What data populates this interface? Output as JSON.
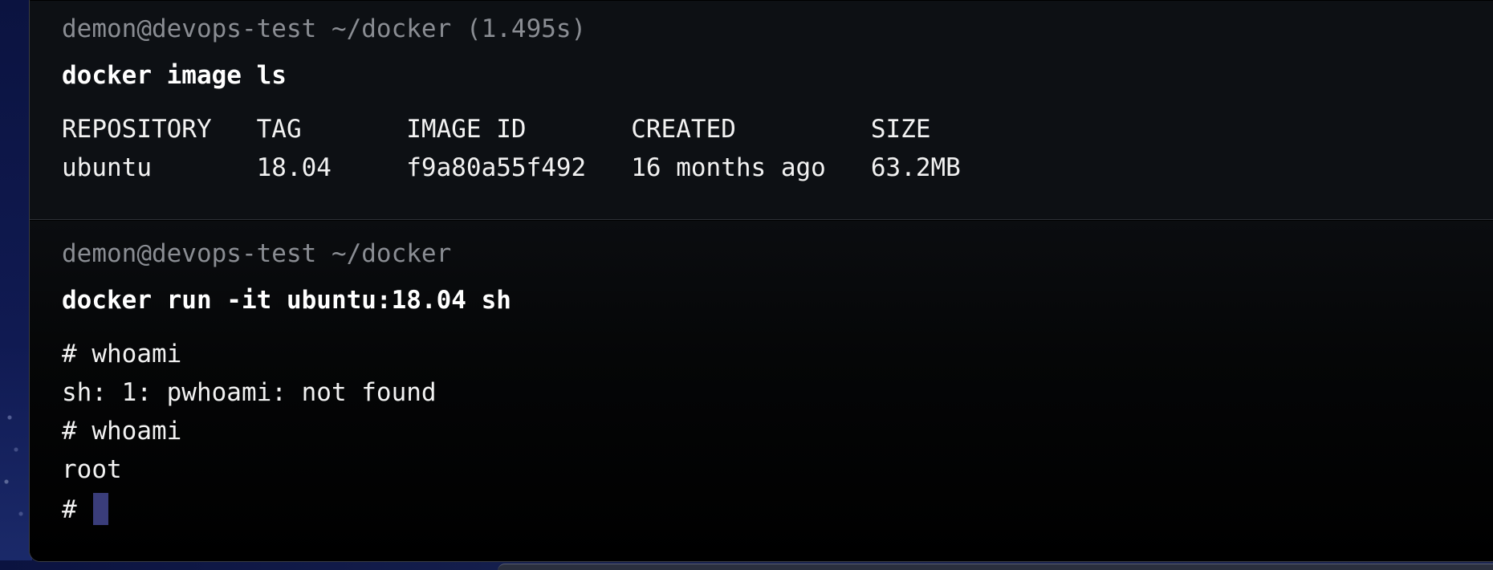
{
  "blocks": [
    {
      "prompt": "demon@devops-test ~/docker (1.495s)",
      "command": "docker image ls",
      "output_lines": [
        "REPOSITORY   TAG       IMAGE ID       CREATED         SIZE",
        "ubuntu       18.04     f9a80a55f492   16 months ago   63.2MB"
      ]
    },
    {
      "prompt": "demon@devops-test ~/docker",
      "command": "docker run -it ubuntu:18.04 sh",
      "output_lines": [
        "# whoami",
        "sh: 1: pwhoami: not found",
        "# whoami",
        "root"
      ],
      "active_prompt": "#"
    }
  ],
  "colors": {
    "terminal_bg": "#000000",
    "block_bg": "#0d1014",
    "prompt_text": "#8a8d93",
    "command_text": "#ffffff",
    "output_text": "#f2f2f2",
    "cursor": "#3a3d7a"
  }
}
